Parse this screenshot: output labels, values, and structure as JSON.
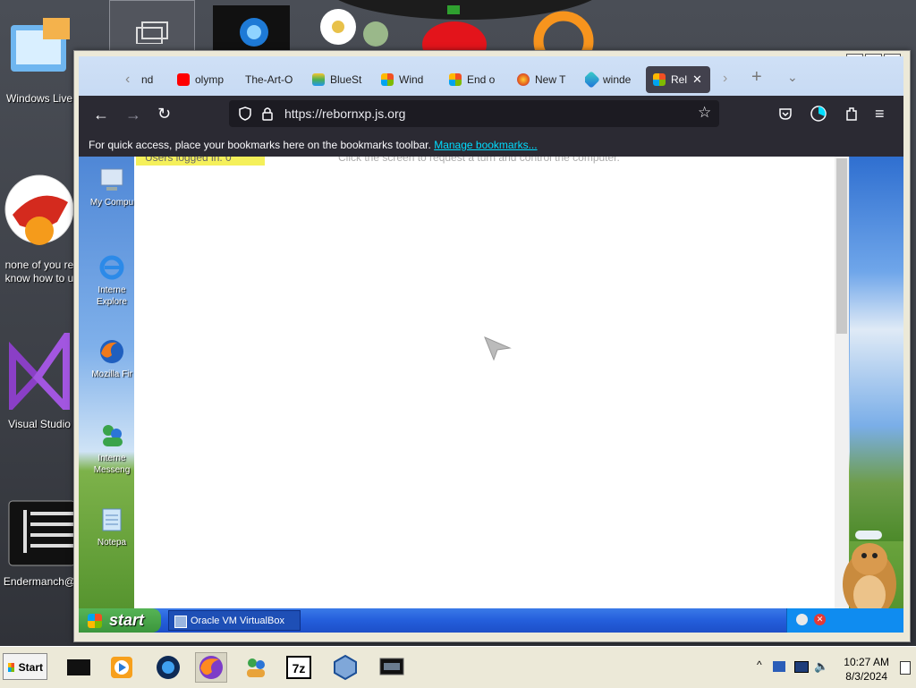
{
  "host_desktop": {
    "icons": [
      {
        "label": "Windows Live"
      },
      {
        "label": "none of you re know how to u"
      },
      {
        "label": "Visual Studio"
      },
      {
        "label": "Endermanch@"
      }
    ]
  },
  "browser": {
    "tabs": [
      {
        "label": "nd"
      },
      {
        "label": "olymp"
      },
      {
        "label": "The-Art-O"
      },
      {
        "label": "BlueSt"
      },
      {
        "label": "Wind"
      },
      {
        "label": "End o"
      },
      {
        "label": "New T"
      },
      {
        "label": "winde"
      },
      {
        "label": "Rel",
        "active": true
      }
    ],
    "url": "https://rebornxp.js.org",
    "bookmarks_message": "For quick access, place your bookmarks here on the bookmarks toolbar.",
    "bookmarks_link": "Manage bookmarks..."
  },
  "page": {
    "users_logged_in": "Users logged in: 0",
    "hint": "Click the screen to request a turn and control the computer.",
    "xp_icons": [
      {
        "label": "My Compu"
      },
      {
        "label": "Interne Explore"
      },
      {
        "label": "Mozilla Fir"
      },
      {
        "label": "Interne Messeng"
      },
      {
        "label": "Notepa"
      }
    ],
    "xp_start_label": "start",
    "xp_task_label": "Oracle VM VirtualBox"
  },
  "host_taskbar": {
    "start_label": "Start",
    "time": "10:27 AM",
    "date": "8/3/2024"
  }
}
